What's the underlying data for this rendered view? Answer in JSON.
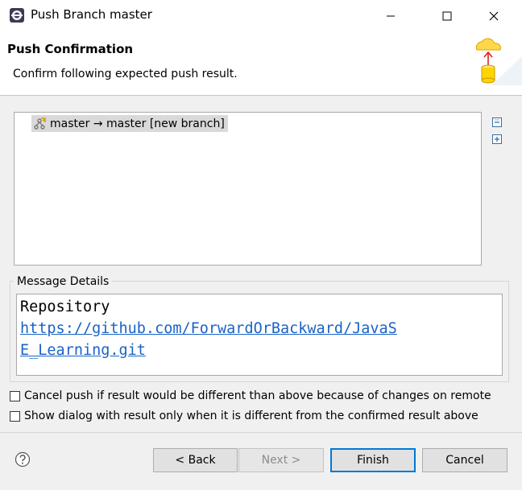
{
  "window": {
    "title": "Push Branch master",
    "icon": "eclipse-icon"
  },
  "header": {
    "title": "Push Confirmation",
    "subtitle": "Confirm following expected push result.",
    "icon": "push-to-cloud-icon"
  },
  "tree": {
    "items": [
      {
        "label": "master → master [new branch]",
        "icon": "branch-icon"
      }
    ],
    "collapse_icon": "collapse-all-icon",
    "expand_icon": "expand-all-icon"
  },
  "message": {
    "group_label": "Message Details",
    "line1": "Repository",
    "link_line1": "https://github.com/ForwardOrBackward/JavaS",
    "link_line2": "E_Learning.git"
  },
  "options": {
    "cancel_push_label": "Cancel push if result would be different than above because of changes on remote",
    "cancel_push_checked": false,
    "show_dialog_label": "Show dialog with result only when it is different from the confirmed result above",
    "show_dialog_checked": false
  },
  "footer": {
    "help_icon": "help-icon",
    "back_label": "< Back",
    "next_label": "Next >",
    "finish_label": "Finish",
    "cancel_label": "Cancel"
  }
}
